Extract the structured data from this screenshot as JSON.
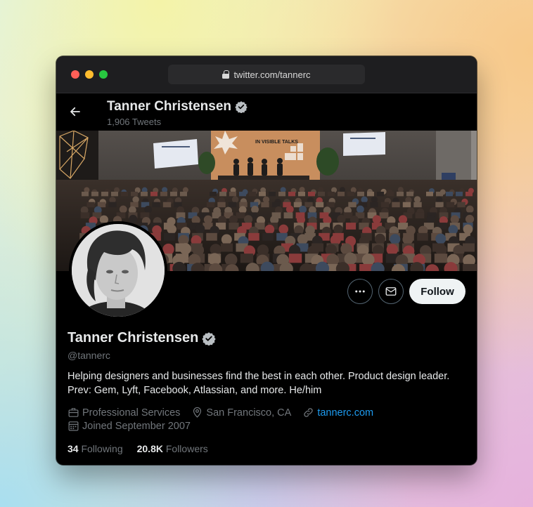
{
  "browser": {
    "url": "twitter.com/tannerc"
  },
  "header": {
    "name": "Tanner Christensen",
    "tweet_count": "1,906 Tweets"
  },
  "profile": {
    "name": "Tanner Christensen",
    "handle": "@tannerc",
    "bio": "Helping designers and businesses find the best in each other. Product design leader. Prev: Gem, Lyft, Facebook, Atlassian, and more. He/him",
    "category": "Professional Services",
    "location": "San Francisco, CA",
    "website": "tannerc.com",
    "joined": "Joined September 2007",
    "following_count": "34",
    "following_label": "Following",
    "followers_count": "20.8K",
    "followers_label": "Followers"
  },
  "actions": {
    "follow_label": "Follow"
  },
  "banner": {
    "stage_sign": "IN VISIBLE TALKS"
  },
  "colors": {
    "accent": "#1d9bf0",
    "background": "#000000",
    "muted": "#71767b"
  }
}
